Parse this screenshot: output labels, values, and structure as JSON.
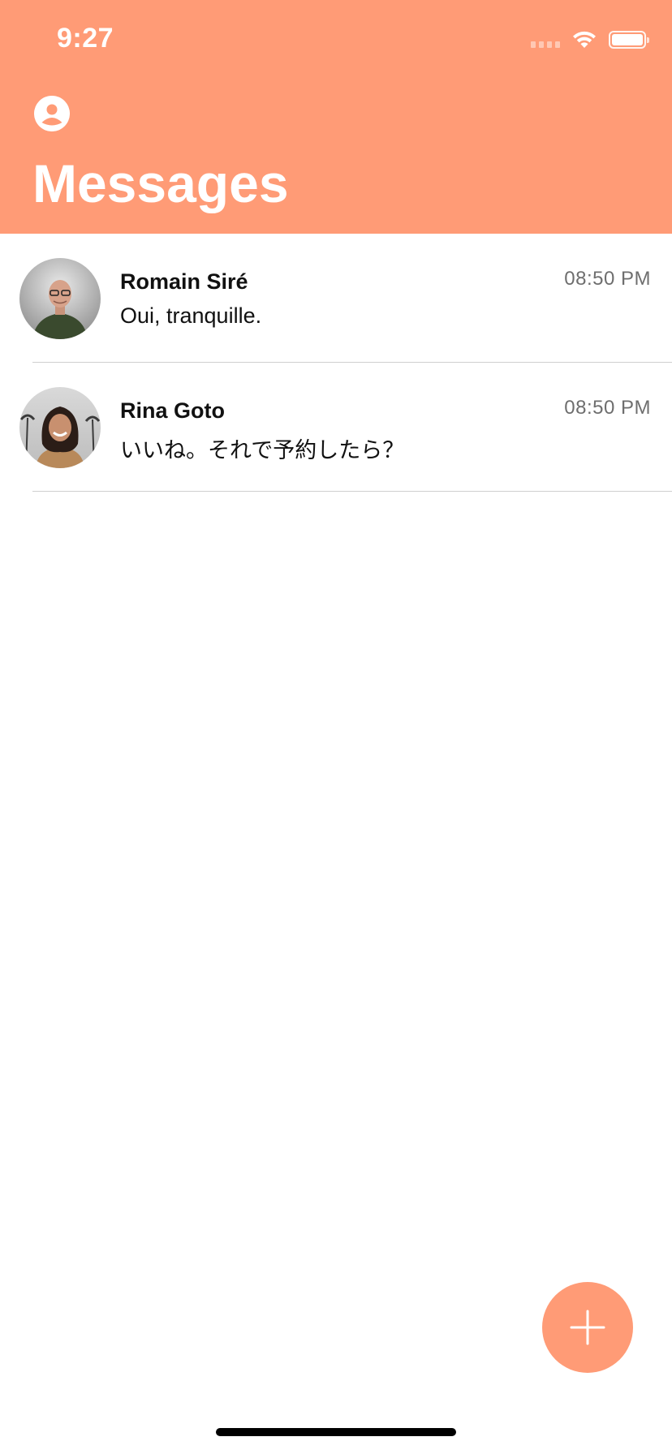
{
  "status_bar": {
    "time": "9:27",
    "icons": [
      "signal-icon",
      "wifi-icon",
      "battery-icon"
    ]
  },
  "header": {
    "title": "Messages",
    "profile_icon": "person-circle-icon",
    "background_color": "#FF9B76"
  },
  "conversations": [
    {
      "name": "Romain Siré",
      "preview": "Oui, tranquille.",
      "time": "08:50 PM"
    },
    {
      "name": "Rina Goto",
      "preview": "いいね。それで予約したら？",
      "time": "08:50 PM"
    }
  ],
  "fab": {
    "icon": "plus-icon",
    "color": "#FF9B76"
  }
}
